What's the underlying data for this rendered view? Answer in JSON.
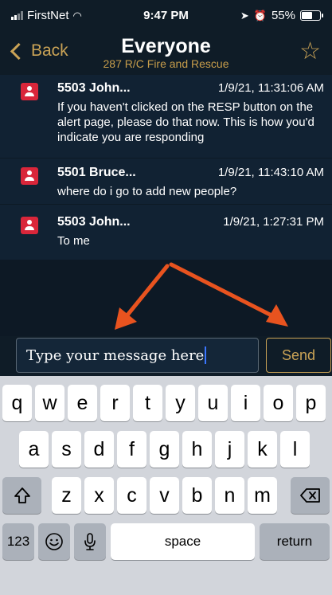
{
  "status_bar": {
    "carrier": "FirstNet",
    "time": "9:47 PM",
    "battery": "55%"
  },
  "nav": {
    "back_label": "Back",
    "title": "Everyone",
    "subtitle": "287 R/C Fire and Rescue"
  },
  "messages": [
    {
      "name": "5503 John...",
      "timestamp": "1/9/21, 11:31:06 AM",
      "body": "If you haven't clicked on the RESP button on the alert page, please do that now. This is how you'd indicate you are responding"
    },
    {
      "name": "5501 Bruce...",
      "timestamp": "1/9/21, 11:43:10 AM",
      "body": "where do i go to add new people?"
    },
    {
      "name": "5503 John...",
      "timestamp": "1/9/21, 1:27:31 PM",
      "body": "To me"
    }
  ],
  "composer": {
    "input_value": "Type your message here",
    "send_label": "Send"
  },
  "keyboard": {
    "row1": [
      "q",
      "w",
      "e",
      "r",
      "t",
      "y",
      "u",
      "i",
      "o",
      "p"
    ],
    "row2": [
      "a",
      "s",
      "d",
      "f",
      "g",
      "h",
      "j",
      "k",
      "l"
    ],
    "row3": [
      "z",
      "x",
      "c",
      "v",
      "b",
      "n",
      "m"
    ],
    "numbers_label": "123",
    "space_label": "space",
    "return_label": "return",
    "shift_icon": "shift-icon",
    "delete_icon": "delete-icon",
    "emoji_icon": "emoji-icon",
    "mic_icon": "microphone-icon"
  },
  "colors": {
    "accent": "#caa356",
    "background": "#0f1c27",
    "avatar": "#d9263a",
    "annotation_arrow": "#e8531f"
  }
}
